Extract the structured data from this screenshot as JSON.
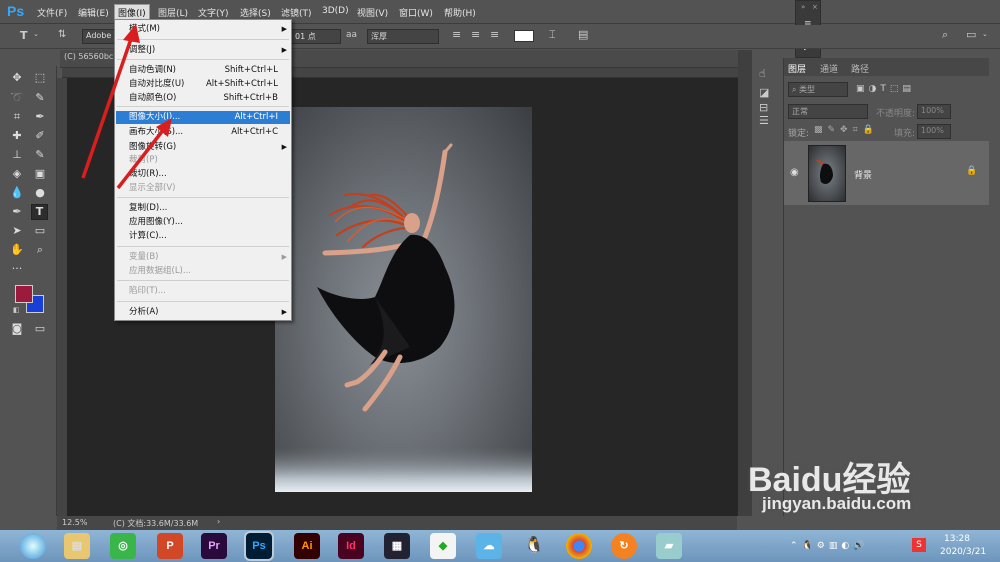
{
  "menubar": {
    "logo": "Ps",
    "items": [
      "文件(F)",
      "编辑(E)",
      "图像(I)",
      "图层(L)",
      "文字(Y)",
      "选择(S)",
      "滤镜(T)",
      "3D(D)",
      "视图(V)",
      "窗口(W)",
      "帮助(H)"
    ]
  },
  "options": {
    "tool_icon": "T",
    "font_family": "Adobe",
    "font_size": "01 点",
    "aa_label": "aa",
    "antialias": "浑厚"
  },
  "document": {
    "tab_title": "(C) 56560bc",
    "zoom": "12.5%",
    "doc_info": "(C) 文档:33.6M/33.6M"
  },
  "image_menu": {
    "items": [
      {
        "label": "模式(M)",
        "shortcut": "",
        "submenu": true,
        "disabled": false
      },
      {
        "label": "调整(J)",
        "shortcut": "",
        "submenu": true,
        "disabled": false
      },
      {
        "label": "自动色调(N)",
        "shortcut": "Shift+Ctrl+L",
        "submenu": false,
        "disabled": false
      },
      {
        "label": "自动对比度(U)",
        "shortcut": "Alt+Shift+Ctrl+L",
        "submenu": false,
        "disabled": false
      },
      {
        "label": "自动颜色(O)",
        "shortcut": "Shift+Ctrl+B",
        "submenu": false,
        "disabled": false
      },
      {
        "label": "图像大小(I)...",
        "shortcut": "Alt+Ctrl+I",
        "submenu": false,
        "disabled": false,
        "highlighted": true
      },
      {
        "label": "画布大小(S)...",
        "shortcut": "Alt+Ctrl+C",
        "submenu": false,
        "disabled": false
      },
      {
        "label": "图像旋转(G)",
        "shortcut": "",
        "submenu": true,
        "disabled": false
      },
      {
        "label": "裁剪(P)",
        "shortcut": "",
        "submenu": false,
        "disabled": true
      },
      {
        "label": "裁切(R)...",
        "shortcut": "",
        "submenu": false,
        "disabled": false
      },
      {
        "label": "显示全部(V)",
        "shortcut": "",
        "submenu": false,
        "disabled": true
      },
      {
        "label": "复制(D)...",
        "shortcut": "",
        "submenu": false,
        "disabled": false
      },
      {
        "label": "应用图像(Y)...",
        "shortcut": "",
        "submenu": false,
        "disabled": false
      },
      {
        "label": "计算(C)...",
        "shortcut": "",
        "submenu": false,
        "disabled": false
      },
      {
        "label": "变量(B)",
        "shortcut": "",
        "submenu": true,
        "disabled": true
      },
      {
        "label": "应用数据组(L)...",
        "shortcut": "",
        "submenu": false,
        "disabled": true
      },
      {
        "label": "陷印(T)...",
        "shortcut": "",
        "submenu": false,
        "disabled": true
      },
      {
        "label": "分析(A)",
        "shortcut": "",
        "submenu": true,
        "disabled": false
      }
    ]
  },
  "layers_panel": {
    "tabs": [
      "图层",
      "通道",
      "路径"
    ],
    "filter_kind": "类型",
    "blend_mode": "正常",
    "opacity_label": "不透明度:",
    "opacity_value": "100%",
    "lock_label": "锁定:",
    "fill_label": "填充:",
    "fill_value": "100%",
    "layer_name": "背景"
  },
  "taskbar": {
    "apps": [
      "Pr",
      "Ps",
      "Ai",
      "Id"
    ],
    "time": "13:28",
    "date": "2020/3/21"
  },
  "watermark": {
    "brand": "Baidu经验",
    "url": "jingyan.baidu.com"
  },
  "colors": {
    "ps_blue": "#31a8ff",
    "highlight": "#2c7dd4",
    "foreground": "#9b1a3e",
    "background": "#1a3fd6",
    "arrow_red": "#d81e1e"
  }
}
